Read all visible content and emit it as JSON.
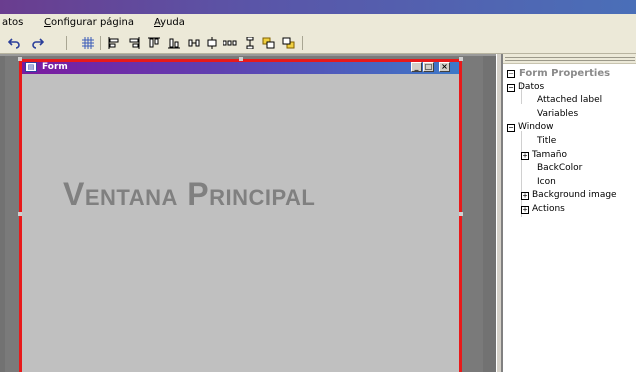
{
  "menu": {
    "item1": "atos",
    "item2_first": "C",
    "item2_rest": "onfigurar página",
    "item3_first": "A",
    "item3_rest": "yuda"
  },
  "toolbar": {
    "icons": [
      "undo-icon",
      "redo-icon",
      "grid-icon",
      "align-left-icon",
      "align-center-icon",
      "align-right-icon",
      "align-top-icon",
      "align-middle-icon",
      "align-bottom-icon",
      "space-horizontal-icon",
      "space-vertical-icon",
      "bring-front-icon",
      "send-back-icon"
    ]
  },
  "form": {
    "title": "Form",
    "minimize": "_",
    "maximize": "□",
    "close": "×",
    "label": "Ventana Principal"
  },
  "properties": {
    "header": "Form Properties",
    "rows": [
      {
        "text": "Datos",
        "toggle": "−",
        "level": 0
      },
      {
        "text": "Attached label",
        "toggle": "",
        "level": 2
      },
      {
        "text": "Variables",
        "toggle": "",
        "level": 2
      },
      {
        "text": "Window",
        "toggle": "−",
        "level": 0
      },
      {
        "text": "Title",
        "toggle": "",
        "level": 2
      },
      {
        "text": "Tamaño",
        "toggle": "+",
        "level": 1
      },
      {
        "text": "BackColor",
        "toggle": "",
        "level": 2
      },
      {
        "text": "Icon",
        "toggle": "",
        "level": 2
      },
      {
        "text": "Background image",
        "toggle": "+",
        "level": 1
      },
      {
        "text": "Actions",
        "toggle": "+",
        "level": 1
      }
    ]
  }
}
